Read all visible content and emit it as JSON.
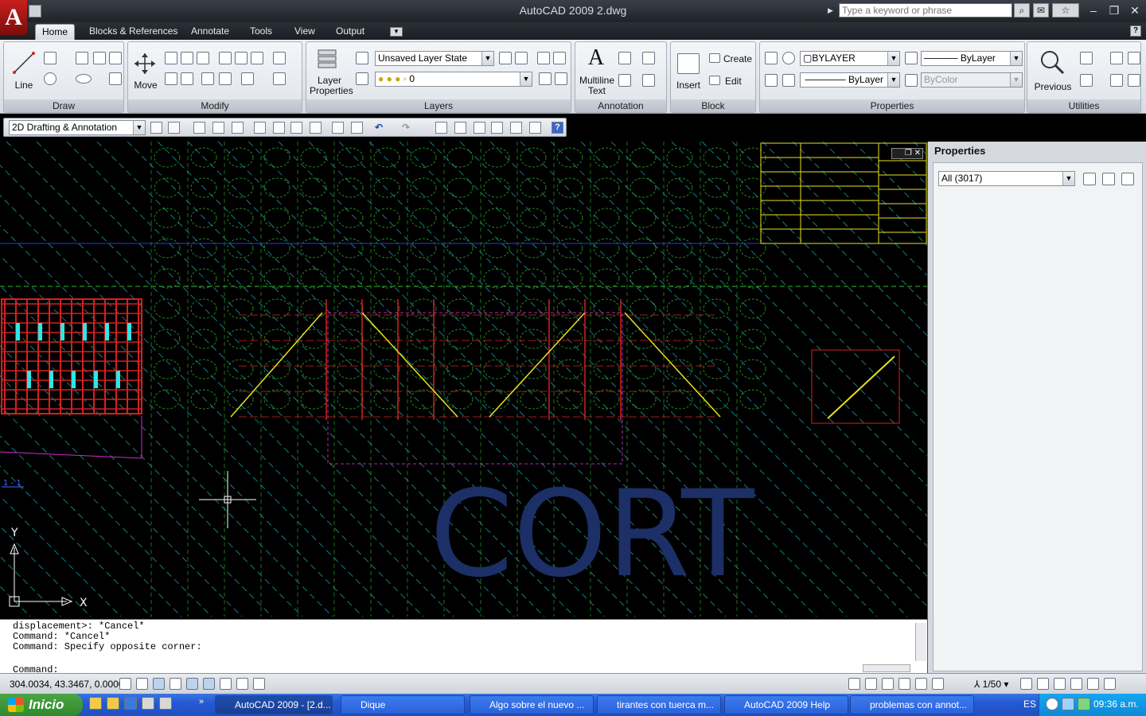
{
  "app": {
    "title": "AutoCAD 2009 2.dwg",
    "logo_letter": "A",
    "search_placeholder": "Type a keyword or phrase"
  },
  "tabs": [
    "Home",
    "Blocks & References",
    "Annotate",
    "Tools",
    "View",
    "Output"
  ],
  "ribbon": {
    "draw": {
      "title": "Draw",
      "line_label": "Line"
    },
    "modify": {
      "title": "Modify",
      "move_label": "Move"
    },
    "layers": {
      "title": "Layers",
      "layer_properties_label": "Layer Properties",
      "layer_state": "Unsaved Layer State",
      "current_layer": "0"
    },
    "annotation": {
      "title": "Annotation",
      "mtext_label": "Multiline Text"
    },
    "block": {
      "title": "Block",
      "insert_label": "Insert",
      "create_label": "Create",
      "edit_label": "Edit"
    },
    "properties": {
      "title": "Properties",
      "color": "BYLAYER",
      "linetype": "ByLayer",
      "lineweight": "ByLayer",
      "plotstyle": "ByColor"
    },
    "utilities": {
      "title": "Utilities",
      "previous_label": "Previous"
    }
  },
  "workspace": {
    "current": "2D Drafting & Annotation"
  },
  "drawing": {
    "big_text": "CORT",
    "view_label": "1 - 1",
    "ucs_x": "X",
    "ucs_y": "Y"
  },
  "properties_palette": {
    "title": "Properties",
    "selection": "All (3017)"
  },
  "command_line": {
    "history": [
      "displacement>: *Cancel*",
      "Command: *Cancel*",
      "Command: Specify opposite corner:"
    ],
    "prompt": "Command:"
  },
  "status_bar": {
    "coordinates": "304.0034, 43.3467, 0.0000",
    "annotation_scale": "1/50"
  },
  "taskbar": {
    "start_label": "Inicio",
    "tasks": [
      "AutoCAD 2009 - [2.d...",
      "Dique",
      "Algo sobre el nuevo ...",
      "tirantes con tuerca m...",
      "AutoCAD 2009 Help",
      "problemas con annot..."
    ],
    "language": "ES",
    "clock": "09:36 a.m."
  },
  "colors": {
    "grid_green": "#2fbf2f",
    "red_lines": "#d42020",
    "cyan_dash": "#1fa7a7",
    "blue_text": "#1c2f66",
    "yellow": "#e7e21a"
  }
}
